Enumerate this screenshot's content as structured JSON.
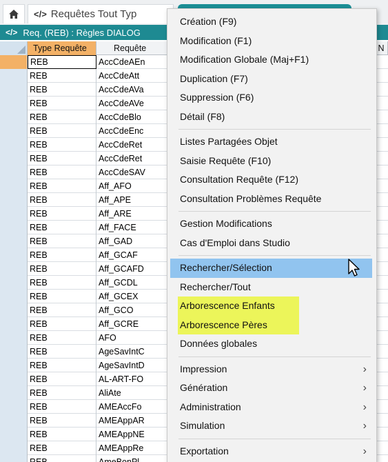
{
  "tabs": {
    "home_icon": "home-icon",
    "doc_tab_code": "</>",
    "doc_tab_title": "Requêtes Tout Typ"
  },
  "subheader": {
    "code": "</>",
    "title": "Req. (REB) : Règles DIALOG"
  },
  "grid": {
    "columns": [
      "Type Requête",
      "Requête"
    ],
    "right_headers": [
      ".",
      "N"
    ],
    "rows": [
      [
        "REB",
        "AccCdeAEn"
      ],
      [
        "REB",
        "AccCdeAtt"
      ],
      [
        "REB",
        "AccCdeAVa"
      ],
      [
        "REB",
        "AccCdeAVe"
      ],
      [
        "REB",
        "AccCdeBlo"
      ],
      [
        "REB",
        "AccCdeEnc"
      ],
      [
        "REB",
        "AccCdeRet"
      ],
      [
        "REB",
        "AccCdeRet"
      ],
      [
        "REB",
        "AccCdeSAV"
      ],
      [
        "REB",
        "Aff_AFO"
      ],
      [
        "REB",
        "Aff_APE"
      ],
      [
        "REB",
        "Aff_ARE"
      ],
      [
        "REB",
        "Aff_FACE"
      ],
      [
        "REB",
        "Aff_GAD"
      ],
      [
        "REB",
        "Aff_GCAF"
      ],
      [
        "REB",
        "Aff_GCAFD"
      ],
      [
        "REB",
        "Aff_GCDL"
      ],
      [
        "REB",
        "Aff_GCEX"
      ],
      [
        "REB",
        "Aff_GCO"
      ],
      [
        "REB",
        "Aff_GCRE"
      ],
      [
        "REB",
        "AFO"
      ],
      [
        "REB",
        "AgeSavIntC"
      ],
      [
        "REB",
        "AgeSavIntD"
      ],
      [
        "REB",
        "AL-ART-FO"
      ],
      [
        "REB",
        "AliAte"
      ],
      [
        "REB",
        "AMEAccFo"
      ],
      [
        "REB",
        "AMEAppAR"
      ],
      [
        "REB",
        "AMEAppNE"
      ],
      [
        "REB",
        "AMEAppRe"
      ],
      [
        "REB",
        "AmeBonPl"
      ]
    ]
  },
  "menu": {
    "group1": [
      "Création (F9)",
      "Modification (F1)",
      "Modification Globale (Maj+F1)",
      "Duplication (F7)",
      "Suppression (F6)",
      "Détail (F8)"
    ],
    "group2": [
      "Listes Partagées Objet",
      "Saisie Requête (F10)",
      "Consultation Requête (F12)",
      "Consultation Problèmes Requête"
    ],
    "group3": [
      "Gestion Modifications",
      "Cas d'Emploi dans Studio"
    ],
    "group4": [
      "Rechercher/Sélection",
      "Rechercher/Tout",
      "Arborescence Enfants",
      "Arborescence Pères",
      "Données globales"
    ],
    "group5": [
      "Impression",
      "Génération",
      "Administration",
      "Simulation"
    ],
    "group6": [
      "Exportation"
    ],
    "submenu_arrow": "›",
    "highlight_color": "#ecf55a",
    "hover_color": "#91c4ef"
  },
  "colors": {
    "teal": "#1e8a92",
    "active_header": "#f3b166"
  }
}
